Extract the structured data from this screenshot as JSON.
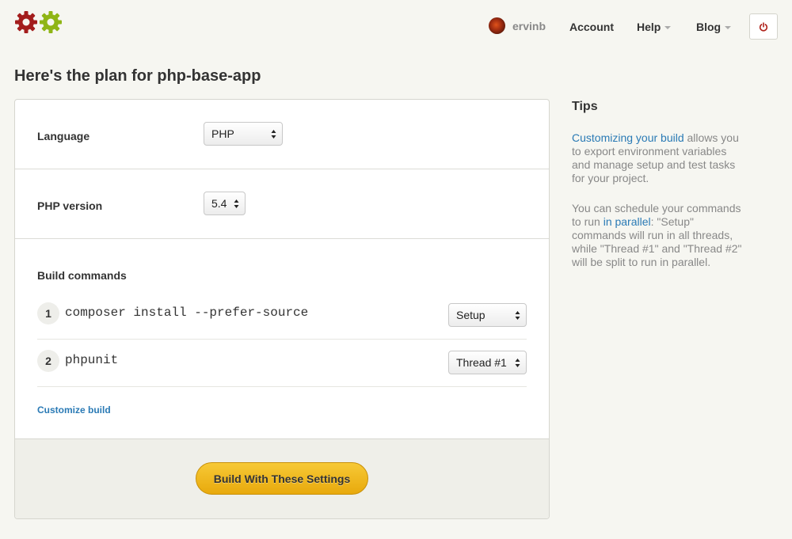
{
  "header": {
    "user": {
      "name": "ervinb"
    },
    "nav": [
      {
        "label": "Account",
        "has_caret": false
      },
      {
        "label": "Help",
        "has_caret": true
      },
      {
        "label": "Blog",
        "has_caret": true
      }
    ],
    "logo_colors": [
      "#a31d1d",
      "#8fb515"
    ],
    "icons": [
      "logo-gears-icon",
      "avatar",
      "chevron-down-icon",
      "power-icon"
    ]
  },
  "page": {
    "title": "Here's the plan for php-base-app"
  },
  "form": {
    "language": {
      "label": "Language",
      "value": "PHP"
    },
    "php_version": {
      "label": "PHP version",
      "value": "5.4"
    },
    "build_commands": {
      "label": "Build commands",
      "items": [
        {
          "number": "1",
          "command": "composer install --prefer-source",
          "thread": "Setup"
        },
        {
          "number": "2",
          "command": "phpunit",
          "thread": "Thread #1"
        }
      ]
    },
    "customize_link": "Customize build",
    "build_button": "Build With These Settings"
  },
  "tips": {
    "title": "Tips",
    "tip1": {
      "link": "Customizing your build",
      "text": " allows you to export environment variables and manage setup and test tasks for your project."
    },
    "tip2": {
      "text_before": "You can schedule your commands to run ",
      "link": "in parallel",
      "text_after": ": \"Setup\" commands will run in all threads, while \"Thread #1\" and \"Thread #2\" will be split to run in parallel."
    }
  },
  "colors": {
    "accent": "#2a7ab5",
    "button": "#f0b81f",
    "power": "#b0231c"
  }
}
